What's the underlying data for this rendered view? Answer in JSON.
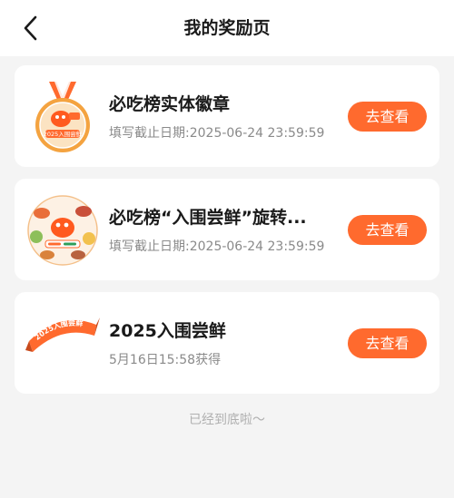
{
  "header": {
    "title": "我的奖励页",
    "back_icon": "chevron-left-icon"
  },
  "colors": {
    "accent": "#ff6a2e",
    "background": "#f4f4f4",
    "card": "#ffffff",
    "muted_text": "#8a8a8a"
  },
  "rewards": [
    {
      "title": "必吃榜实体徽章",
      "subtitle": "填写截止日期:2025-06-24 23:59:59",
      "button": "去查看",
      "image": "medal-badge-image",
      "image_text": "2025入围尝鲜"
    },
    {
      "title": "必吃榜“入围尝鲜”旋转...",
      "subtitle": "填写截止日期:2025-06-24 23:59:59",
      "button": "去查看",
      "image": "rotating-food-badge-image"
    },
    {
      "title": "2025入围尝鲜",
      "subtitle": "5月16日15:58获得",
      "button": "去查看",
      "image": "ribbon-badge-image",
      "image_text": "2025入围尝鲜"
    }
  ],
  "footer": {
    "end_text": "已经到底啦～"
  }
}
